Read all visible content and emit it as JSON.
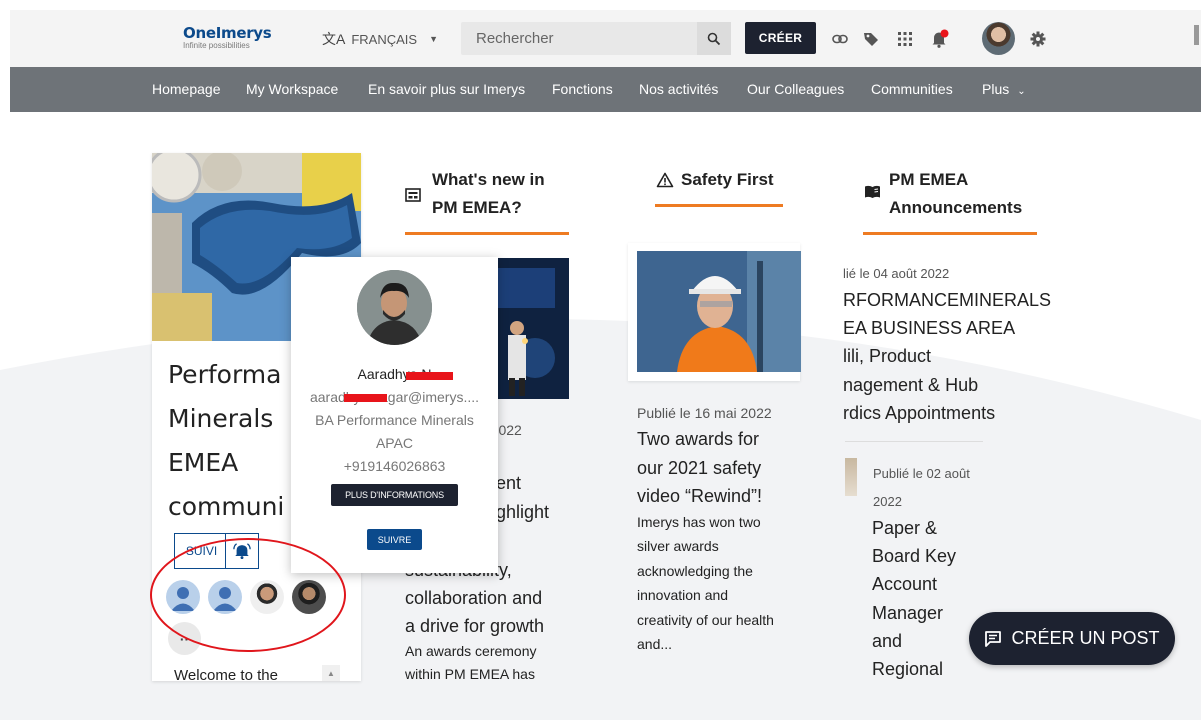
{
  "header": {
    "logo_main": "OneImerys",
    "logo_sub": "Infinite possibilities",
    "language": "FRANÇAIS",
    "search_placeholder": "Rechercher",
    "create_label": "CRÉER"
  },
  "icons": [
    "link-icon",
    "tag-icon",
    "apps-grid-icon",
    "notification-bell-icon",
    "user-avatar",
    "gear-icon"
  ],
  "nav": {
    "items": [
      "Homepage",
      "My Workspace",
      "En savoir plus sur Imerys",
      "Fonctions",
      "Nos activités",
      "Our Colleagues",
      "Communities",
      "Plus"
    ]
  },
  "community": {
    "title_lines": [
      "Performa",
      "Minerals",
      "EMEA",
      "communi"
    ],
    "follow_label": "SUIVI",
    "more_members": "··",
    "welcome": "Welcome to the"
  },
  "popup": {
    "name": "Aaradhya N",
    "email": "aaradhya.nagar@imerys....",
    "role": "BA Performance Minerals",
    "region": "APAC",
    "phone": "+919146026863",
    "more_info_label": "PLUS D'INFORMATIONS",
    "follow_label": "SUIVRE"
  },
  "whats_new": {
    "heading_lines": [
      "What's new in",
      "PM EMEA?"
    ],
    "date": "n 2022",
    "text_lines": [
      "ent",
      "ghlight",
      "sustainability,",
      "collaboration and",
      "a drive for growth"
    ],
    "desc_lines": [
      "An awards ceremony",
      "within PM EMEA has"
    ]
  },
  "safety": {
    "heading": "Safety First",
    "date": "Publié le 16 mai 2022",
    "title_lines": [
      "Two awards for",
      "our 2021 safety",
      "video “Rewind”!"
    ],
    "desc_lines": [
      "Imerys has won two",
      "silver awards",
      "acknowledging the",
      "innovation and",
      "creativity of our health",
      "and..."
    ]
  },
  "announcements": {
    "heading_lines": [
      "PM EMEA",
      "Announcements"
    ],
    "item1_date": "lié le 04 août 2022",
    "item1_lines": [
      "RFORMANCEMINERALS",
      "EA BUSINESS AREA",
      "lili, Product",
      "nagement & Hub",
      "rdics Appointments"
    ],
    "item2_date_lines": [
      "Publié le 02 août",
      "2022"
    ],
    "item2_lines": [
      "Paper &",
      "Board Key",
      "Account",
      "Manager",
      "and",
      "Regional"
    ]
  },
  "fab": {
    "label": "CRÉER UN POST"
  },
  "colors": {
    "brand_dark": "#1d2230",
    "accent_orange": "#ee7b22",
    "link_blue": "#0b4a8c",
    "nav_grey": "#6e7378",
    "annotation_red": "#e0161c"
  }
}
